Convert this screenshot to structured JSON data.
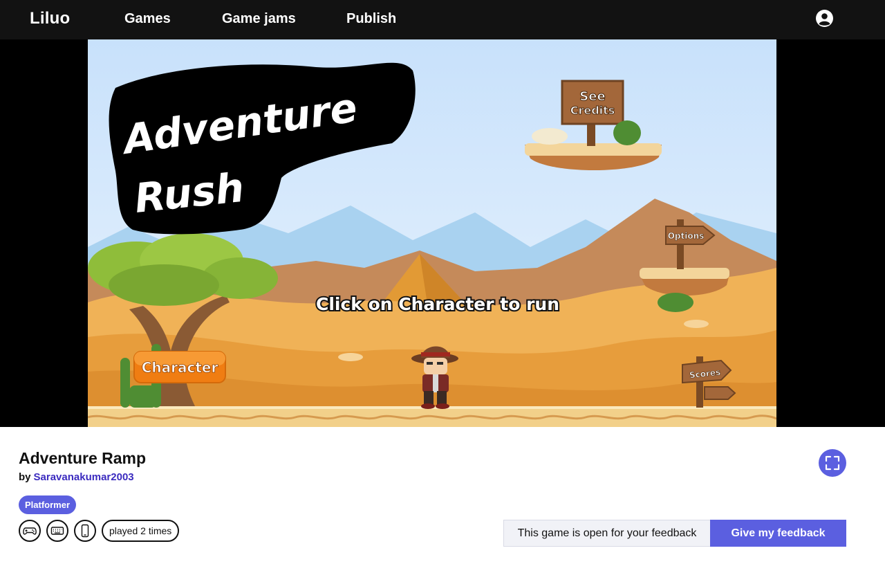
{
  "nav": {
    "brand": "Liluo",
    "links": [
      "Games",
      "Game jams",
      "Publish"
    ],
    "account_icon": "user-circle-icon"
  },
  "game_screen": {
    "logo_line1": "Adventure",
    "logo_line2": "Rush",
    "sign_credits_line1": "See",
    "sign_credits_line2": "Credits",
    "sign_options": "Options",
    "sign_scores": "Scores",
    "instruction": "Click on Character to run",
    "character_button": "Character"
  },
  "game": {
    "title": "Adventure Ramp",
    "by_label": "by",
    "author": "Saravanakumar2003",
    "tag": "Platformer",
    "controls_icons": [
      "gamepad-icon",
      "keyboard-icon",
      "mobile-icon"
    ],
    "played": "played 2 times",
    "fullscreen_icon": "fullscreen-icon"
  },
  "feedback": {
    "info": "This game is open for your feedback",
    "button": "Give my feedback"
  },
  "colors": {
    "topbar": "#121212",
    "accent": "#5b5fe0",
    "author_link": "#3b2bbf",
    "sky": "#cfe6fb",
    "sand": "#e8a040"
  }
}
